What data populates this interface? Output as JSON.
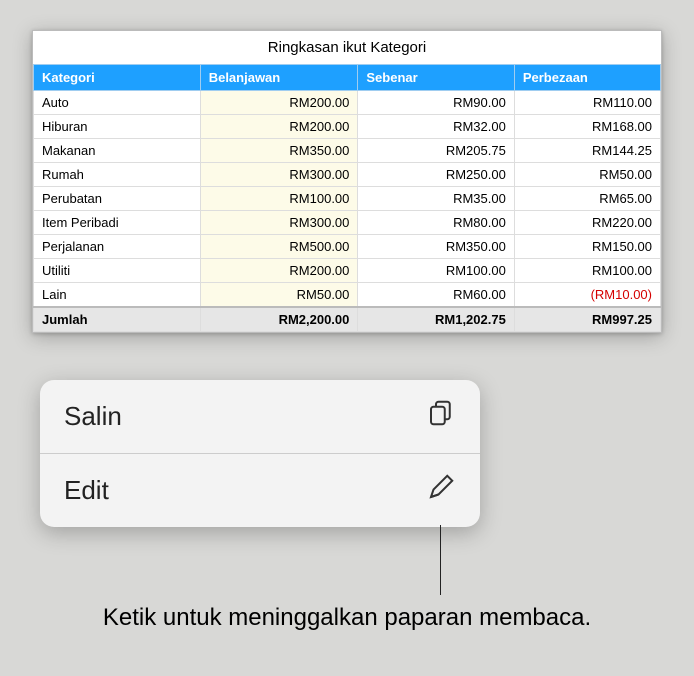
{
  "sheet": {
    "title": "Ringkasan ikut Kategori",
    "headers": [
      "Kategori",
      "Belanjawan",
      "Sebenar",
      "Perbezaan"
    ],
    "rows": [
      {
        "cat": "Auto",
        "budget": "RM200.00",
        "actual": "RM90.00",
        "diff": "RM110.00"
      },
      {
        "cat": "Hiburan",
        "budget": "RM200.00",
        "actual": "RM32.00",
        "diff": "RM168.00"
      },
      {
        "cat": "Makanan",
        "budget": "RM350.00",
        "actual": "RM205.75",
        "diff": "RM144.25"
      },
      {
        "cat": "Rumah",
        "budget": "RM300.00",
        "actual": "RM250.00",
        "diff": "RM50.00"
      },
      {
        "cat": "Perubatan",
        "budget": "RM100.00",
        "actual": "RM35.00",
        "diff": "RM65.00"
      },
      {
        "cat": "Item Peribadi",
        "budget": "RM300.00",
        "actual": "RM80.00",
        "diff": "RM220.00"
      },
      {
        "cat": "Perjalanan",
        "budget": "RM500.00",
        "actual": "RM350.00",
        "diff": "RM150.00"
      },
      {
        "cat": "Utiliti",
        "budget": "RM200.00",
        "actual": "RM100.00",
        "diff": "RM100.00"
      },
      {
        "cat": "Lain",
        "budget": "RM50.00",
        "actual": "RM60.00",
        "diff": "(RM10.00)",
        "neg": true
      }
    ],
    "total": {
      "cat": "Jumlah",
      "budget": "RM2,200.00",
      "actual": "RM1,202.75",
      "diff": "RM997.25"
    }
  },
  "menu": {
    "copy": "Salin",
    "edit": "Edit"
  },
  "caption": "Ketik untuk meninggalkan paparan membaca."
}
